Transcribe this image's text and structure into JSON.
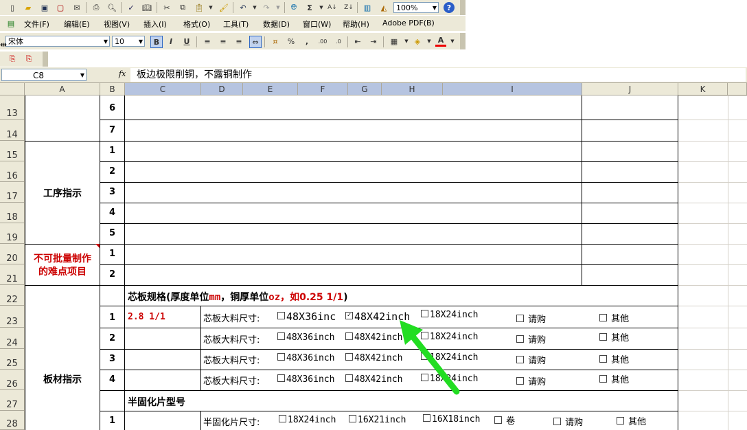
{
  "toolbar": {
    "zoom": "100%",
    "font_name": "宋体",
    "font_size": "10"
  },
  "menu": [
    "文件(F)",
    "编辑(E)",
    "视图(V)",
    "插入(I)",
    "格式(O)",
    "工具(T)",
    "数据(D)",
    "窗口(W)",
    "帮助(H)",
    "Adobe PDF(B)"
  ],
  "formula_bar": {
    "cell_ref": "C8",
    "fx": "fx",
    "content": "板边极限削铜，不露铜制作"
  },
  "columns": [
    "A",
    "B",
    "C",
    "D",
    "E",
    "F",
    "G",
    "H",
    "I",
    "J",
    "K"
  ],
  "rows": [
    "13",
    "14",
    "15",
    "16",
    "17",
    "18",
    "19",
    "20",
    "21",
    "22",
    "23",
    "24",
    "25",
    "26",
    "27",
    "28"
  ],
  "sheet": {
    "seq_13": "6",
    "seq_14": "7",
    "process_label": "工序指示",
    "proc_nums": [
      "1",
      "2",
      "3",
      "4",
      "5"
    ],
    "hard_label_1": "不可批量制作",
    "hard_label_2": "的难点项目",
    "hard_nums": [
      "1",
      "2"
    ],
    "core_title": "芯板规格(厚度单位",
    "core_unit1": "mm",
    "core_mid": "，铜厚单位",
    "core_unit2": "oz",
    "core_example": "，如0.25 1/1",
    "core_end": ")",
    "board_label": "板材指示",
    "core_nums": [
      "1",
      "2",
      "3",
      "4"
    ],
    "core_value_1": "2.8 1/1",
    "core_size_label": "芯板大料尺寸:",
    "core_opts": [
      "48X36inch",
      "48X42inch",
      "18X24inch",
      "请购",
      "其他"
    ],
    "core_opt_first_row1": "48X36inc",
    "prepreg_title": "半固化片型号",
    "prepreg_num": "1",
    "prepreg_size_label": "半固化片尺寸:",
    "prepreg_opts": [
      "18X24inch",
      "16X21inch",
      "16X18inch",
      "卷",
      "请购",
      "其他"
    ]
  },
  "colors": {
    "red_text": "#cc0000",
    "arrow": "#22dd22",
    "header_selected": "#b6c4e0"
  }
}
